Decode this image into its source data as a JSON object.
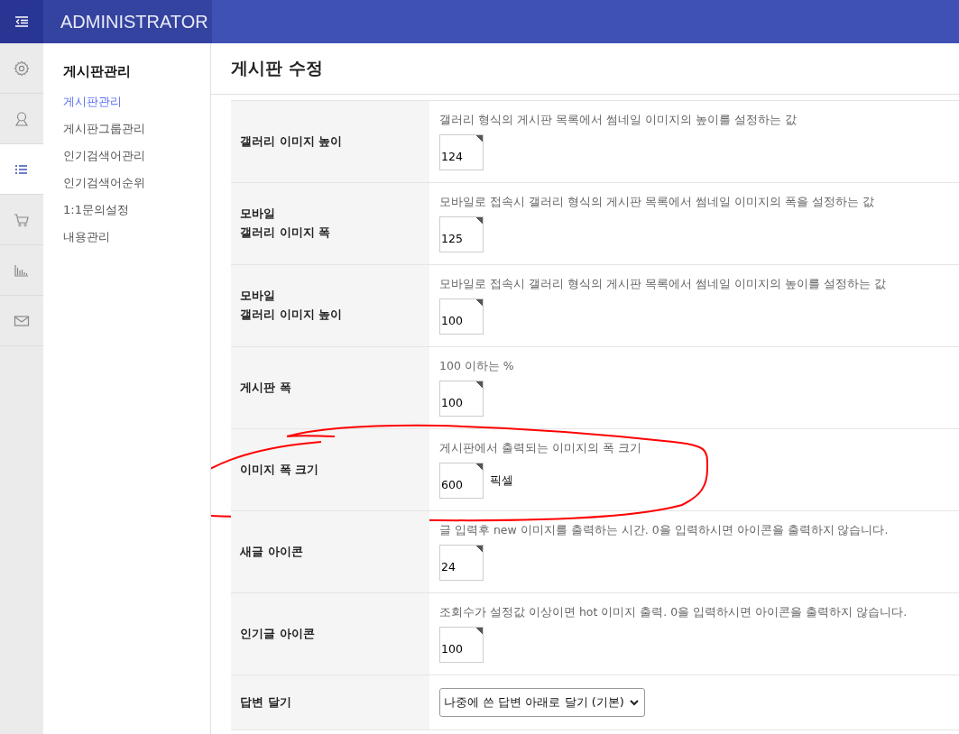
{
  "topbar": {
    "title": "ADMINISTRATOR"
  },
  "rail": [
    {
      "selected": false
    },
    {
      "selected": false
    },
    {
      "selected": true
    },
    {
      "selected": false
    },
    {
      "selected": false
    },
    {
      "selected": false
    }
  ],
  "sidebar": {
    "heading": "게시판관리",
    "items": [
      {
        "label": "게시판관리",
        "selected": true
      },
      {
        "label": "게시판그룹관리",
        "selected": false
      },
      {
        "label": "인기검색어관리",
        "selected": false
      },
      {
        "label": "인기검색어순위",
        "selected": false
      },
      {
        "label": "1:1문의설정",
        "selected": false
      },
      {
        "label": "내용관리",
        "selected": false
      }
    ]
  },
  "page": {
    "title": "게시판 수정"
  },
  "rows": [
    {
      "kind": "number",
      "label": [
        "갤러리 이미지 높이"
      ],
      "description": "갤러리 형식의 게시판 목록에서 썸네일 이미지의 높이를 설정하는 값",
      "value": "124"
    },
    {
      "kind": "number",
      "label": [
        "모바일",
        "갤러리 이미지 폭"
      ],
      "description": "모바일로 접속시 갤러리 형식의 게시판 목록에서 썸네일 이미지의 폭을 설정하는 값",
      "value": "125"
    },
    {
      "kind": "number",
      "label": [
        "모바일",
        "갤러리 이미지 높이"
      ],
      "description": "모바일로 접속시 갤러리 형식의 게시판 목록에서 썸네일 이미지의 높이를 설정하는 값",
      "value": "100"
    },
    {
      "kind": "number",
      "label": [
        "게시판 폭"
      ],
      "description": "100 이하는 %",
      "value": "100"
    },
    {
      "kind": "number",
      "label": [
        "이미지 폭 크기"
      ],
      "description": "게시판에서 출력되는 이미지의 폭 크기",
      "value": "600",
      "unit": "픽셀",
      "annotated": true
    },
    {
      "kind": "number",
      "label": [
        "새글 아이콘"
      ],
      "description": "글 입력후 new 이미지를 출력하는 시간. 0을 입력하시면 아이콘을 출력하지 않습니다.",
      "value": "24"
    },
    {
      "kind": "number",
      "label": [
        "인기글 아이콘"
      ],
      "description": "조회수가 설정값 이상이면 hot 이미지 출력. 0을 입력하시면 아이콘을 출력하지 않습니다.",
      "value": "100"
    },
    {
      "kind": "select",
      "label": [
        "답변 달기"
      ],
      "value": "나중에 쓴 답변 아래로 달기 (기본)"
    }
  ]
}
